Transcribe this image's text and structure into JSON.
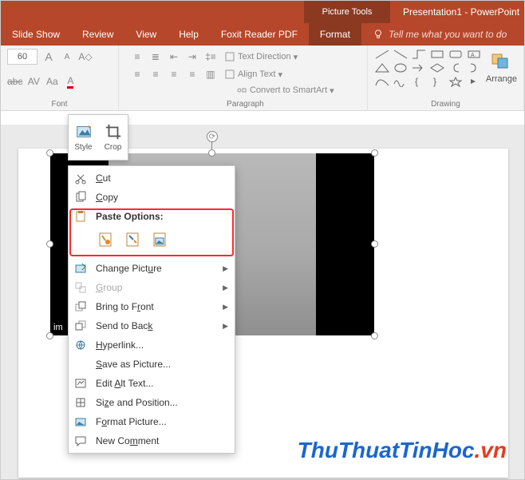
{
  "titlebar": {
    "tools_label": "Picture Tools",
    "title": "Presentation1 - PowerPoint"
  },
  "tabs": {
    "items": [
      "Slide Show",
      "Review",
      "View",
      "Help",
      "Foxit Reader PDF",
      "Format"
    ],
    "active_index": 5,
    "tellme": "Tell me what you want to do"
  },
  "ribbon": {
    "font": {
      "size": "60",
      "group_label": "Font",
      "grow": "A",
      "shrink": "A",
      "strike": "abc",
      "spacing": "AV",
      "case": "Aa",
      "color": "A"
    },
    "paragraph": {
      "group_label": "Paragraph",
      "text_direction": "Text Direction",
      "align_text": "Align Text",
      "convert": "Convert to SmartArt"
    },
    "drawing": {
      "group_label": "Drawing",
      "arrange": "Arrange"
    }
  },
  "minitoolbar": {
    "style": "Style",
    "crop": "Crop"
  },
  "context_menu": {
    "cut": "Cut",
    "copy": "Copy",
    "paste_header": "Paste Options:",
    "change_picture": "Change Picture",
    "group": "Group",
    "bring_front": "Bring to Front",
    "send_back": "Send to Back",
    "hyperlink": "Hyperlink...",
    "save_as_picture": "Save as Picture...",
    "edit_alt": "Edit Alt Text...",
    "size_position": "Size and Position...",
    "format_picture": "Format Picture...",
    "new_comment": "New Comment"
  },
  "slide": {
    "image_label_prefix": "im"
  },
  "watermark": {
    "main": "ThuThuatTinHoc",
    "suffix": ".vn"
  }
}
